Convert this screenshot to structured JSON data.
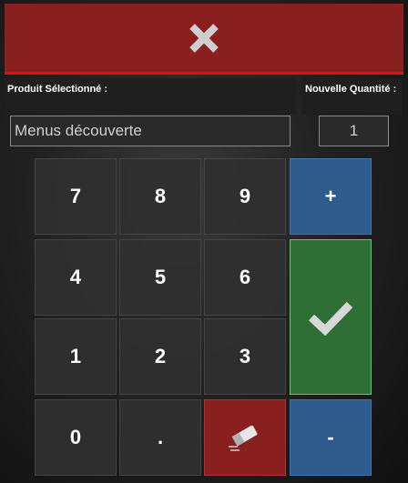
{
  "close_button": {
    "icon": "close-icon"
  },
  "labels": {
    "product": "Produit Sélectionné :",
    "quantity": "Nouvelle Quantité :"
  },
  "product_field": {
    "value": "Menus découverte"
  },
  "quantity_field": {
    "value": "1"
  },
  "keypad": {
    "k7": "7",
    "k8": "8",
    "k9": "9",
    "k4": "4",
    "k5": "5",
    "k6": "6",
    "k1": "1",
    "k2": "2",
    "k3": "3",
    "k0": "0",
    "dot": ".",
    "plus": "+",
    "minus": "-",
    "erase_icon": "eraser-icon",
    "ok_icon": "checkmark-icon"
  },
  "colors": {
    "close": "#8a1f1f",
    "close_border": "#e01010",
    "plus_minus": "#2e5a8c",
    "ok": "#2f6e34",
    "erase": "#8a1f1f"
  }
}
